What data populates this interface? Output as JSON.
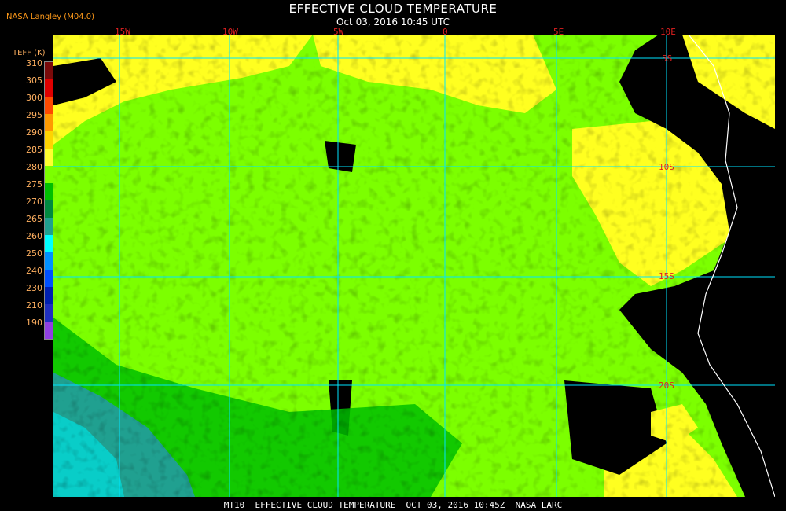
{
  "header": {
    "title": "EFFECTIVE CLOUD TEMPERATURE",
    "subtitle": "Oct 03, 2016 10:45 UTC",
    "credit": "NASA Langley (M04.0)"
  },
  "footer": {
    "text": "MT10  EFFECTIVE CLOUD TEMPERATURE  OCT 03, 2016 10:45Z  NASA LARC"
  },
  "map": {
    "lon_labels": [
      "15W",
      "10W",
      "5W",
      "0",
      "5E",
      "10E"
    ],
    "lat_labels": [
      "5S",
      "10S",
      "15S",
      "20S"
    ],
    "colors": {
      "ocean_cloud": "#7cff00",
      "warm_cloud": "#ffff20",
      "land_black": "#000000",
      "grid": "#00e5ff",
      "coast": "#ffffff",
      "label_red": "#e02020"
    }
  },
  "legend": {
    "title": "TEFF (K)",
    "ticks": [
      "310",
      "305",
      "300",
      "295",
      "290",
      "285",
      "280",
      "275",
      "270",
      "265",
      "260",
      "250",
      "240",
      "230",
      "210",
      "190"
    ],
    "colors": [
      "#7a0a0a",
      "#e00000",
      "#ff4a00",
      "#ff9a00",
      "#ffd400",
      "#ffff30",
      "#7cff00",
      "#00c000",
      "#008a40",
      "#20a090",
      "#00ffff",
      "#0090ff",
      "#0050ff",
      "#0020b0",
      "#2030c0",
      "#9040e0"
    ]
  }
}
